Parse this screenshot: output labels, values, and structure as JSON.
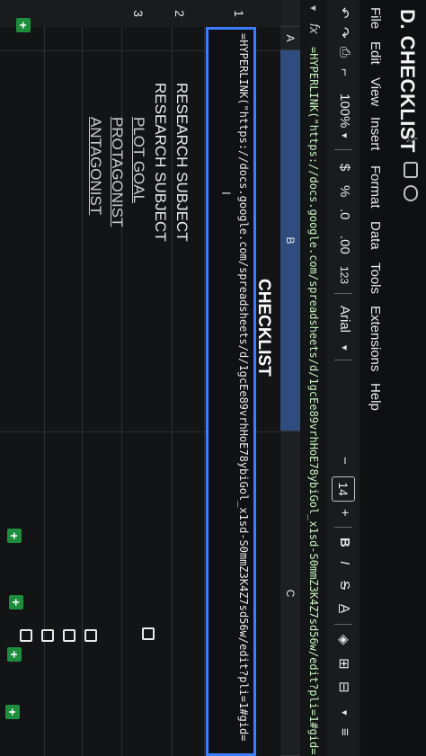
{
  "doc": {
    "title": "D. CHECKLIST"
  },
  "menu": [
    "File",
    "Edit",
    "View",
    "Insert",
    "Format",
    "Data",
    "Tools",
    "Extensions",
    "Help"
  ],
  "toolbar": {
    "zoom": "100%",
    "currency": "$",
    "percent": "%",
    "dec_decrease": ".0",
    "dec_increase": ".00",
    "number_format": "123",
    "font": "Arial",
    "minus": "−",
    "font_size": "14",
    "plus": "+",
    "bold": "B",
    "italic": "I"
  },
  "formula_bar": {
    "fx": "fx",
    "value": "=HYPERLINK(\"https://docs.google.com/spreadsheets/d/1gcEe89vrhHoE78ybiGol_x1sd-S0mmZ3K4Z7sd56w/edit?pli=1#gid="
  },
  "columns": [
    "A",
    "B",
    "C"
  ],
  "rows": [
    "1",
    "2",
    "3"
  ],
  "sheet": {
    "header": "CHECKLIST",
    "active_cell_text": "=HYPERLINK(\"https://docs.google.com/spreadsheets/d/1gcEe89vrhHoE78ybiGol_x1sd-S0mmZ3K4Z7sd56w/edit?pli=1#gid=",
    "items": [
      "RESEARCH SUBJECT",
      "RESEARCH SUBJECT",
      "PLOT GOAL",
      "PROTAGONIST",
      "ANTAGONIST"
    ]
  }
}
